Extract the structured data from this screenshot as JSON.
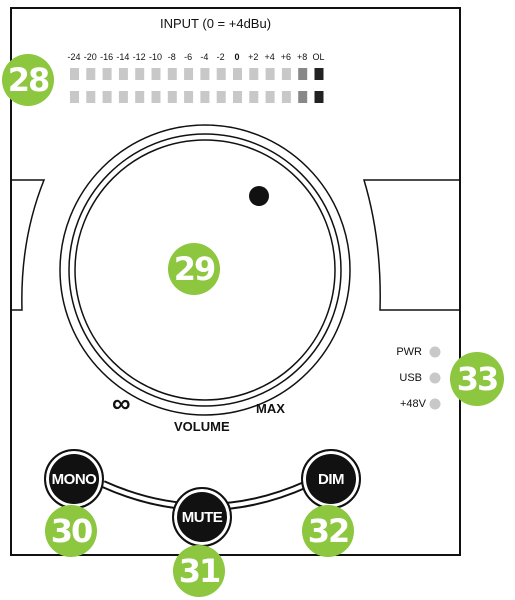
{
  "meter": {
    "title": "INPUT (0 = +4dBu)",
    "ticks": [
      "-24",
      "-20",
      "-16",
      "-14",
      "-12",
      "-10",
      "-8",
      "-6",
      "-4",
      "-2",
      "0",
      "+2",
      "+4",
      "+6",
      "+8",
      "OL"
    ]
  },
  "knob": {
    "label": "VOLUME",
    "min_label": "∞",
    "max_label": "MAX"
  },
  "leds": [
    {
      "label": "PWR"
    },
    {
      "label": "USB"
    },
    {
      "label": "+48V"
    }
  ],
  "buttons": {
    "mono": "MONO",
    "mute": "MUTE",
    "dim": "DIM"
  },
  "callouts": {
    "meter": "28",
    "volume": "29",
    "mono": "30",
    "mute": "31",
    "dim": "32",
    "leds": "33"
  },
  "colors": {
    "callout": "#8dc63f",
    "led_gray": "#c8c8c8",
    "led_mid": "#888888",
    "led_dark": "#222222"
  }
}
